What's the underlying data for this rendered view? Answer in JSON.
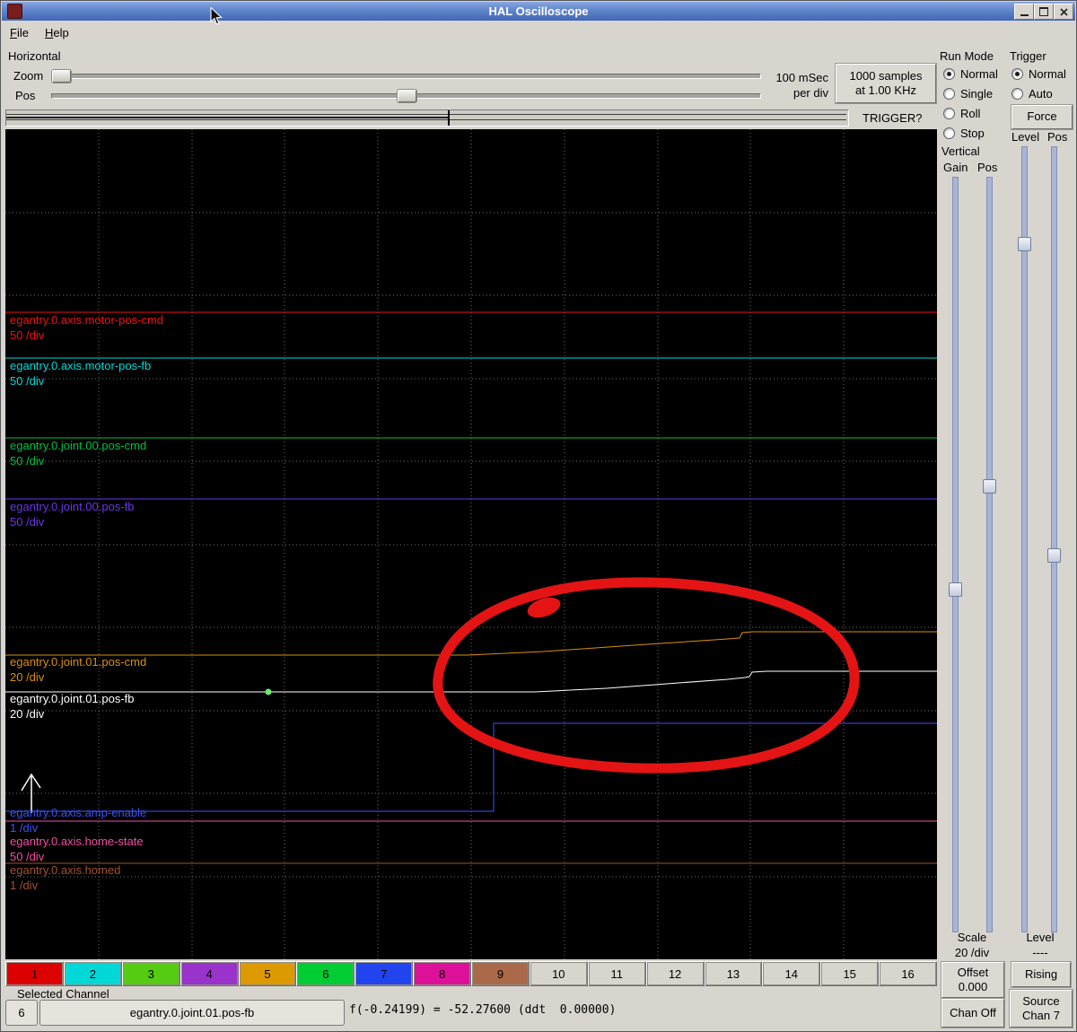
{
  "window": {
    "title": "HAL Oscilloscope"
  },
  "menu": {
    "file": {
      "accel": "F",
      "rest": "ile"
    },
    "help": {
      "accel": "H",
      "rest": "elp"
    }
  },
  "horizontal": {
    "label": "Horizontal",
    "zoom": "Zoom",
    "pos": "Pos",
    "rate1": "100 mSec",
    "rate2": "per div",
    "samples1": "1000 samples",
    "samples2": "at 1.00 KHz",
    "trigger": "TRIGGER?"
  },
  "run_mode": {
    "label": "Run Mode",
    "options": [
      "Normal",
      "Single",
      "Roll",
      "Stop"
    ],
    "selected": "Normal"
  },
  "trigger": {
    "label": "Trigger",
    "options": [
      "Normal",
      "Auto"
    ],
    "selected": "Normal",
    "force": "Force",
    "level": "Level",
    "pos": "Pos",
    "level2": "Level",
    "level_value": "----",
    "rising": "Rising",
    "source1": "Source",
    "source2": "Chan 7"
  },
  "vertical": {
    "label": "Vertical",
    "gain": "Gain",
    "pos": "Pos",
    "scale": "Scale",
    "scale_value": "20 /div",
    "offset1": "Offset",
    "offset2": "0.000",
    "chan_off": "Chan Off"
  },
  "scope": {
    "traces": [
      {
        "name": "egantry.0.axis.motor-pos-cmd",
        "scale": "50 /div",
        "color": "#ee1111"
      },
      {
        "name": "egantry.0.axis.motor-pos-fb",
        "scale": "50 /div",
        "color": "#00d8d8"
      },
      {
        "name": "egantry.0.joint.00.pos-cmd",
        "scale": "50 /div",
        "color": "#00c040"
      },
      {
        "name": "egantry.0.joint.00.pos-fb",
        "scale": "50 /div",
        "color": "#6a35e8"
      },
      {
        "name": "egantry.0.joint.01.pos-cmd",
        "scale": "20 /div",
        "color": "#d89010"
      },
      {
        "name": "egantry.0.joint.01.pos-fb",
        "scale": "20 /div",
        "color": "#ffffff"
      },
      {
        "name": "egantry.0.axis.amp-enable",
        "scale": "1 /div",
        "color": "#3b52f0"
      },
      {
        "name": "egantry.0.axis.home-state",
        "scale": "50 /div",
        "color": "#ee4fa0"
      },
      {
        "name": "egantry.0.axis.homed",
        "scale": "1 /div",
        "color": "#a0522d"
      }
    ],
    "annotation_color": "#e41414"
  },
  "channels": {
    "buttons": [
      {
        "label": "1",
        "color": "#dd0000"
      },
      {
        "label": "2",
        "color": "#00d8d8"
      },
      {
        "label": "3",
        "color": "#55cc11"
      },
      {
        "label": "4",
        "color": "#9933cc"
      },
      {
        "label": "5",
        "color": "#dd9900"
      },
      {
        "label": "6",
        "color": "#00cc33"
      },
      {
        "label": "7",
        "color": "#2244ee"
      },
      {
        "label": "8",
        "color": "#dd1199"
      },
      {
        "label": "9",
        "color": "#aa6a4a"
      },
      {
        "label": "10",
        "color": "#d8d5cf"
      },
      {
        "label": "11",
        "color": "#d8d5cf"
      },
      {
        "label": "12",
        "color": "#d8d5cf"
      },
      {
        "label": "13",
        "color": "#d8d5cf"
      },
      {
        "label": "14",
        "color": "#d8d5cf"
      },
      {
        "label": "15",
        "color": "#d8d5cf"
      },
      {
        "label": "16",
        "color": "#d8d5cf"
      }
    ]
  },
  "status": {
    "selected_channel_label": "Selected Channel",
    "channel_number": "6",
    "channel_name": "egantry.0.joint.01.pos-fb",
    "readout": "f(-0.24199) = -52.27600 (ddt  0.00000)"
  }
}
